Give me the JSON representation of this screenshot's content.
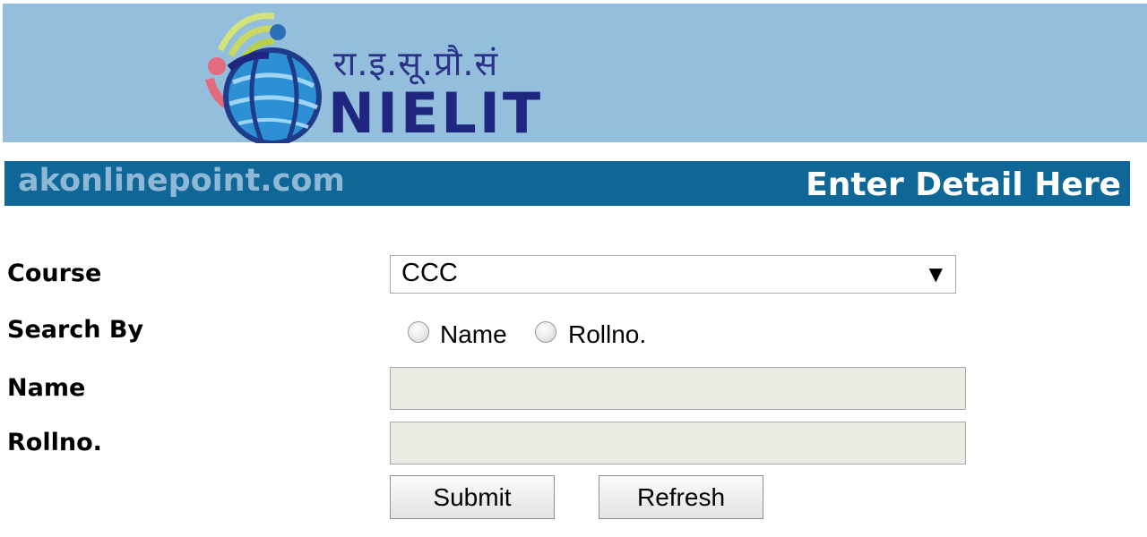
{
  "header": {
    "logo_hindi": "रा.इ.सू.प्रौ.सं",
    "logo_name": "NIELIT",
    "banner_color": "#93bfdc"
  },
  "strip": {
    "site": "akonlinepoint.com",
    "heading": "Enter Detail Here",
    "color": "#0e6797"
  },
  "form": {
    "course_label": "Course",
    "course_value": "CCC",
    "search_by_label": "Search By",
    "radio_name_label": "Name",
    "radio_rollno_label": "Rollno.",
    "name_label": "Name",
    "rollno_label": "Rollno.",
    "name_value": "",
    "rollno_value": "",
    "submit_label": "Submit",
    "refresh_label": "Refresh"
  }
}
